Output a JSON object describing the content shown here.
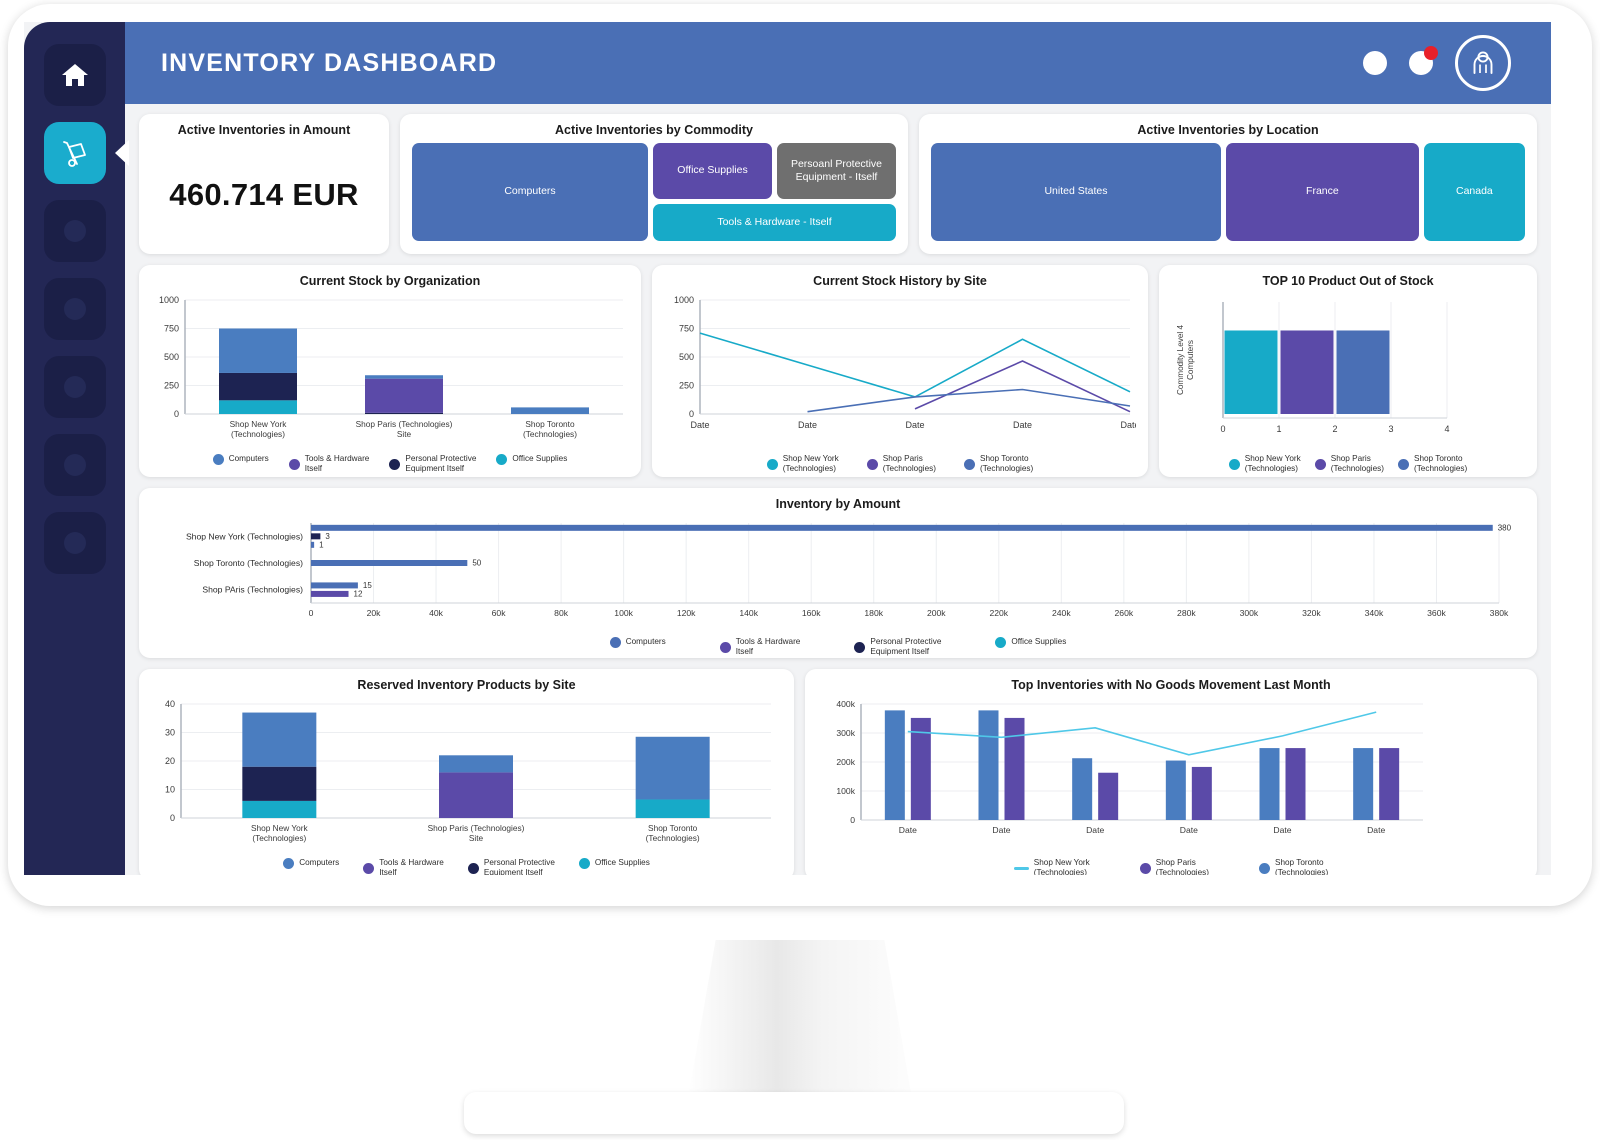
{
  "header": {
    "title": "INVENTORY DASHBOARD",
    "icons": [
      "circle-icon",
      "notification-icon",
      "user-avatar-icon"
    ]
  },
  "sidebar": {
    "items": [
      {
        "name": "home",
        "icon": "home-icon",
        "active": false
      },
      {
        "name": "inventory",
        "icon": "hand-truck-icon",
        "active": true
      },
      {
        "name": "nav-3",
        "icon": "dot-icon",
        "active": false
      },
      {
        "name": "nav-4",
        "icon": "dot-icon",
        "active": false
      },
      {
        "name": "nav-5",
        "icon": "dot-icon",
        "active": false
      },
      {
        "name": "nav-6",
        "icon": "dot-icon",
        "active": false
      },
      {
        "name": "nav-7",
        "icon": "dot-icon",
        "active": false
      }
    ]
  },
  "colors": {
    "blue": "#4a6fb5",
    "blue_light": "#4a7dc0",
    "purple": "#5b4aa8",
    "navy": "#1d2352",
    "teal": "#17aac8",
    "gray": "#6f6f6f",
    "header_blue": "#4a6fb5",
    "sidebar": "#232755",
    "accent_red": "#e8202a"
  },
  "kpi": {
    "title": "Active Inventories in Amount",
    "value": "460.714 EUR"
  },
  "chart_data": [
    {
      "id": "commodity-treemap",
      "type": "treemap",
      "title": "Active Inventories by Commodity",
      "tiles": [
        {
          "label": "Computers",
          "color": "#4a6fb5",
          "weight": 62
        },
        {
          "label": "Office Supplies",
          "color": "#5b4aa8",
          "weight": 13
        },
        {
          "label": "Persoanl Protective Equipment - Itself",
          "color": "#6f6f6f",
          "weight": 13
        },
        {
          "label": "Tools & Hardware - Itself",
          "color": "#17aac8",
          "weight": 12
        }
      ]
    },
    {
      "id": "location-treemap",
      "type": "treemap",
      "title": "Active Inventories by Location",
      "tiles": [
        {
          "label": "United States",
          "color": "#4a6fb5",
          "weight": 50
        },
        {
          "label": "France",
          "color": "#5b4aa8",
          "weight": 33
        },
        {
          "label": "Canada",
          "color": "#17aac8",
          "weight": 17
        }
      ]
    },
    {
      "id": "current-stock-by-organization",
      "type": "bar",
      "stacked": true,
      "title": "Current Stock by Organization",
      "categories": [
        "Shop New York\n(Technologies)",
        "Shop Paris (Technologies)\nSite",
        "Shop Toronto\n(Technologies)"
      ],
      "series": [
        {
          "name": "Computers",
          "color": "#4a7dc0",
          "values": [
            390,
            30,
            58
          ]
        },
        {
          "name": "Tools & Hardware\nItself",
          "color": "#5b4aa8",
          "values": [
            0,
            300,
            0
          ]
        },
        {
          "name": "Personal Protective\nEquipment Itself",
          "color": "#1d2352",
          "values": [
            240,
            10,
            0
          ]
        },
        {
          "name": "Office Supplies",
          "color": "#17aac8",
          "values": [
            120,
            0,
            0
          ]
        }
      ],
      "ylim": [
        0,
        1000
      ],
      "yticks": [
        0,
        250,
        500,
        750,
        1000
      ],
      "ylabel": "",
      "xlabel": ""
    },
    {
      "id": "current-stock-history-by-site",
      "type": "line",
      "title": "Current Stock History by Site",
      "x": [
        "Date",
        "Date",
        "Date",
        "Date",
        "Date"
      ],
      "series": [
        {
          "name": "Shop New York\n(Technologies)",
          "color": "#17aac8",
          "values": [
            710,
            430,
            150,
            655,
            195
          ]
        },
        {
          "name": "Shop Paris\n(Technologies)",
          "color": "#5b4aa8",
          "values": [
            null,
            null,
            45,
            465,
            20
          ]
        },
        {
          "name": "Shop Toronto\n(Technologies)",
          "color": "#4a6fb5",
          "values": [
            null,
            20,
            150,
            215,
            70
          ]
        }
      ],
      "ylim": [
        0,
        1000
      ],
      "yticks": [
        0,
        250,
        500,
        750,
        1000
      ]
    },
    {
      "id": "top-10-product-out-of-stock",
      "type": "bar",
      "orientation": "horizontal",
      "title": "TOP 10 Product Out of Stock",
      "ylabel": "Commodity Level 4\nComputers",
      "xticks": [
        0,
        1,
        2,
        3,
        4
      ],
      "xlim": [
        0,
        4
      ],
      "series": [
        {
          "name": "Shop New York\n(Technologies)",
          "color": "#17aac8",
          "value": 1
        },
        {
          "name": "Shop Paris\n(Technologies)",
          "color": "#5b4aa8",
          "value": 1
        },
        {
          "name": "Shop Toronto\n(Technologies)",
          "color": "#4a6fb5",
          "value": 1
        }
      ]
    },
    {
      "id": "inventory-by-amount",
      "type": "bar",
      "orientation": "horizontal",
      "title": "Inventory by Amount",
      "categories": [
        "Shop New York (Technologies)",
        "Shop Toronto (Technologies)",
        "Shop PAris (Technologies)"
      ],
      "xticks": [
        "0",
        "20k",
        "40k",
        "60k",
        "80k",
        "100k",
        "120k",
        "140k",
        "160k",
        "180k",
        "200k",
        "220k",
        "240k",
        "260k",
        "280k",
        "300k",
        "320k",
        "340k",
        "360k",
        "380k"
      ],
      "xlim": [
        0,
        380000
      ],
      "bars": [
        {
          "row": 0,
          "color": "#4a6fb5",
          "value": 378000,
          "label": "380"
        },
        {
          "row": 0,
          "color": "#1d2352",
          "value": 3000,
          "label": "3"
        },
        {
          "row": 0,
          "color": "#4a6fb5",
          "value": 1000,
          "label": "1"
        },
        {
          "row": 1,
          "color": "#4a6fb5",
          "value": 50000,
          "label": "50"
        },
        {
          "row": 2,
          "color": "#4a6fb5",
          "value": 15000,
          "label": "15"
        },
        {
          "row": 2,
          "color": "#5b4aa8",
          "value": 12000,
          "label": "12"
        }
      ],
      "legend": [
        {
          "name": "Computers",
          "color": "#4a6fb5"
        },
        {
          "name": "Tools & Hardware\nItself",
          "color": "#5b4aa8"
        },
        {
          "name": "Personal Protective\nEquipment Itself",
          "color": "#1d2352"
        },
        {
          "name": "Office Supplies",
          "color": "#17aac8"
        }
      ]
    },
    {
      "id": "reserved-inventory-products-by-site",
      "type": "bar",
      "stacked": true,
      "title": "Reserved Inventory Products by Site",
      "categories": [
        "Shop New York\n(Technologies)",
        "Shop Paris (Technologies)\nSite",
        "Shop Toronto\n(Technologies)"
      ],
      "series": [
        {
          "name": "Computers",
          "color": "#4a7dc0",
          "values": [
            19,
            6,
            22
          ]
        },
        {
          "name": "Tools & Hardware\nItself",
          "color": "#5b4aa8",
          "values": [
            0,
            16,
            0
          ]
        },
        {
          "name": "Personal Protective\nEquipment Itself",
          "color": "#1d2352",
          "values": [
            12,
            0,
            0
          ]
        },
        {
          "name": "Office Supplies",
          "color": "#17aac8",
          "values": [
            6,
            0,
            6.5
          ]
        }
      ],
      "ylim": [
        0,
        40
      ],
      "yticks": [
        0,
        10,
        20,
        30,
        40
      ]
    },
    {
      "id": "top-inventories-with-no-goods-movement-last-month",
      "type": "bar",
      "title": "Top Inventories with No Goods Movement Last Month",
      "categories": [
        "Date",
        "Date",
        "Date",
        "Date",
        "Date",
        "Date"
      ],
      "ylim": [
        0,
        400000
      ],
      "yticks": [
        "0",
        "100k",
        "200k",
        "300k",
        "400k"
      ],
      "series": [
        {
          "name": "Shop Toronto\n(Technologies)",
          "color": "#4a7dc0",
          "values": [
            378000,
            378000,
            213000,
            205000,
            248000,
            248000
          ],
          "kind": "bar"
        },
        {
          "name": "Shop Paris\n(Technologies)",
          "color": "#5b4aa8",
          "values": [
            352000,
            352000,
            163000,
            183000,
            248000,
            248000
          ],
          "kind": "bar"
        },
        {
          "name": "Shop New York\n(Technologies)",
          "color": "#4fc8e8",
          "values": [
            305000,
            285000,
            318000,
            225000,
            290000,
            372000
          ],
          "kind": "line"
        }
      ]
    }
  ]
}
